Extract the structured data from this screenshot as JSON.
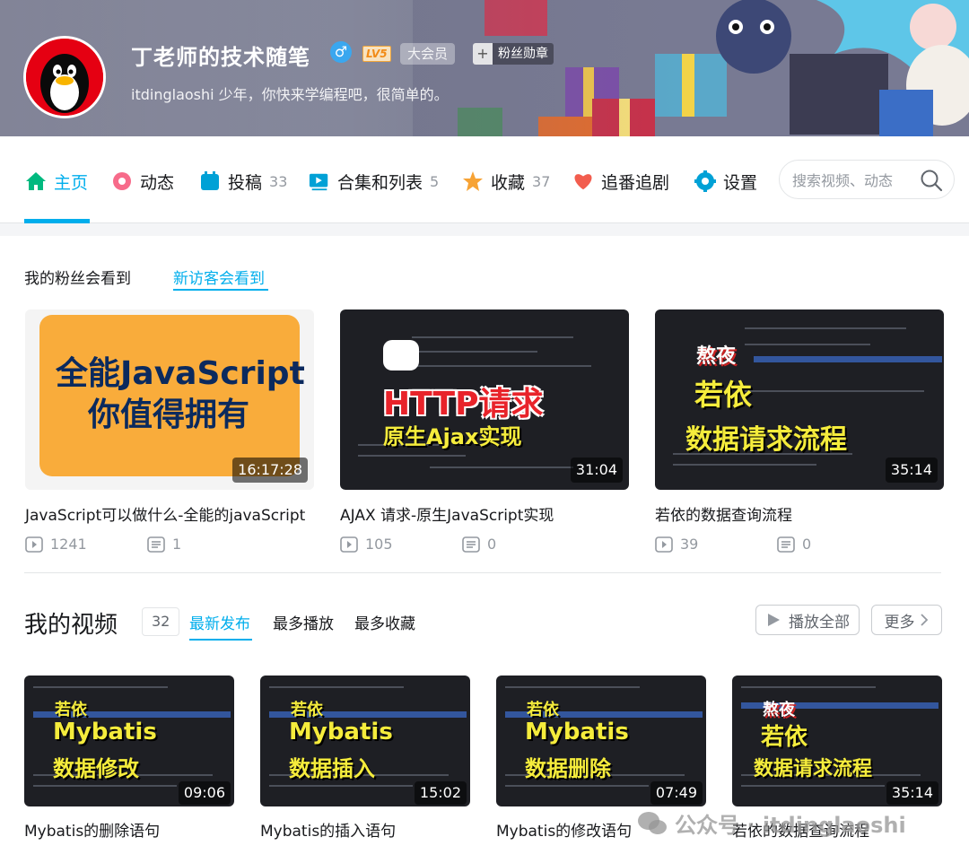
{
  "profile": {
    "name": "丁老师的技术随笔",
    "level": "LV5",
    "vip_label": "大会员",
    "fan_badge_label": "粉丝勋章",
    "sign": "itdinglaoshi 少年，你快来学编程吧，很简单的。"
  },
  "nav": {
    "items": [
      {
        "label": "主页",
        "count": ""
      },
      {
        "label": "动态",
        "count": ""
      },
      {
        "label": "投稿",
        "count": "33"
      },
      {
        "label": "合集和列表",
        "count": "5"
      },
      {
        "label": "收藏",
        "count": "37"
      },
      {
        "label": "追番追剧",
        "count": ""
      },
      {
        "label": "设置",
        "count": ""
      }
    ],
    "search_placeholder": "搜索视频、动态"
  },
  "recommend": {
    "tabs": [
      "我的粉丝会看到",
      "新访客会看到"
    ],
    "cards": [
      {
        "thumb_line1": "全能JavaScript",
        "thumb_line2": "你值得拥有",
        "duration": "16:17:28",
        "title": "JavaScript可以做什么-全能的javaScript",
        "views": "1241",
        "danmaku": "1"
      },
      {
        "thumb_line1": "HTTP请求",
        "thumb_line2": "原生Ajax实现",
        "duration": "31:04",
        "title": "AJAX 请求-原生JavaScript实现",
        "views": "105",
        "danmaku": "0"
      },
      {
        "thumb_line1": "熬夜",
        "thumb_line2": "若依",
        "thumb_line3": "数据请求流程",
        "duration": "35:14",
        "title": "若依的数据查询流程",
        "views": "39",
        "danmaku": "0"
      }
    ]
  },
  "my_videos": {
    "title": "我的视频",
    "count": "32",
    "tabs": [
      "最新发布",
      "最多播放",
      "最多收藏"
    ],
    "play_all_label": "播放全部",
    "more_label": "更多",
    "videos": [
      {
        "tag": "若依",
        "line1": "Mybatis",
        "line2": "数据修改",
        "duration": "09:06",
        "title": "Mybatis的删除语句"
      },
      {
        "tag": "若依",
        "line1": "Mybatis",
        "line2": "数据插入",
        "duration": "15:02",
        "title": "Mybatis的插入语句"
      },
      {
        "tag": "若依",
        "line1": "Mybatis",
        "line2": "数据删除",
        "duration": "07:49",
        "title": "Mybatis的修改语句"
      },
      {
        "tag": "熬夜",
        "line1": "若依",
        "line2": "数据请求流程",
        "duration": "35:14",
        "title": "若依的数据查询流程"
      }
    ]
  },
  "watermark": "公众号 · itdinglaoshi",
  "colors": {
    "accent": "#00aeec",
    "text": "#18191c",
    "muted": "#9499a0",
    "thumb_yellow": "#f5ec3c",
    "thumb_red": "#e8232a"
  }
}
